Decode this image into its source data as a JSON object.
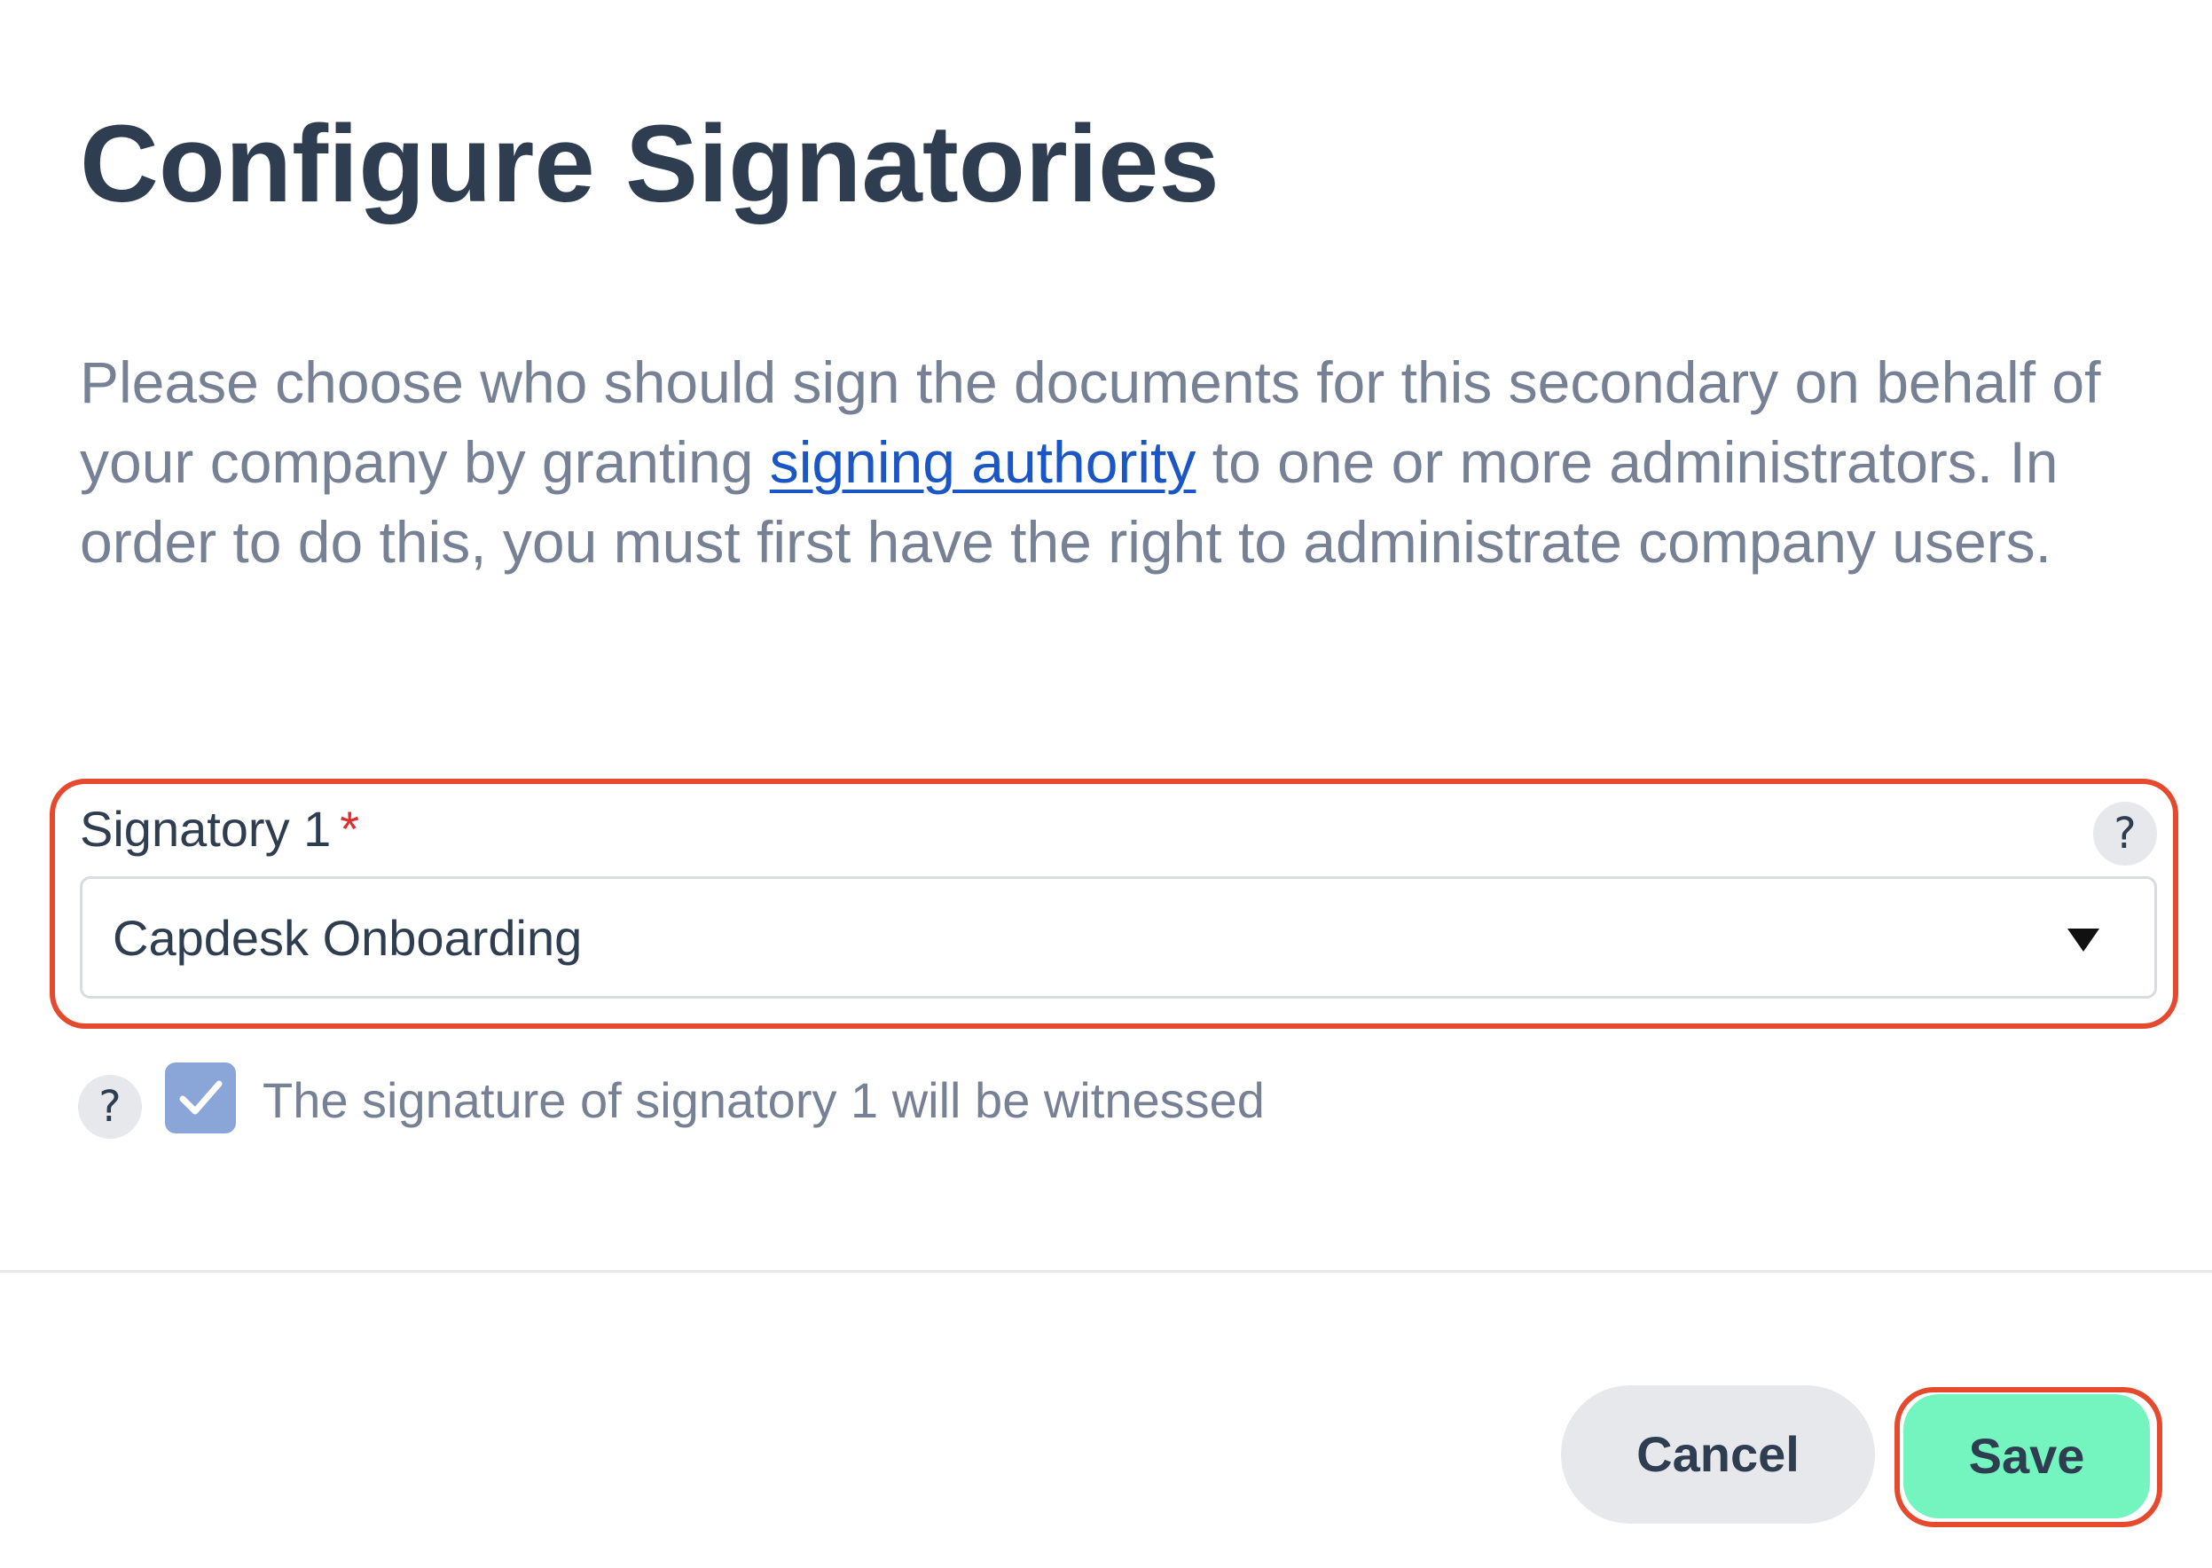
{
  "dialog": {
    "title": "Configure Signatories",
    "description_before_link": "Please choose who should sign the documents for this secondary on behalf of your company by granting ",
    "description_link": "signing authority",
    "description_after_link": " to one or more administrators. In order to do this, you must first have the right to administrate company users."
  },
  "signatory_field": {
    "label": "Signatory 1",
    "required_marker": "*",
    "help_icon": "question-mark-icon",
    "help_glyph": "?",
    "selected_value": "Capdesk Onboarding"
  },
  "witness": {
    "help_icon": "question-mark-icon",
    "help_glyph": "?",
    "checked": true,
    "label": "The signature of signatory 1 will be witnessed"
  },
  "footer": {
    "cancel_label": "Cancel",
    "save_label": "Save"
  },
  "colors": {
    "title": "#2f3d51",
    "body_text": "#778196",
    "link": "#1a56c5",
    "highlight": "#e54a2e",
    "save_button": "#74f5bf",
    "checkbox": "#8aa6d8"
  }
}
